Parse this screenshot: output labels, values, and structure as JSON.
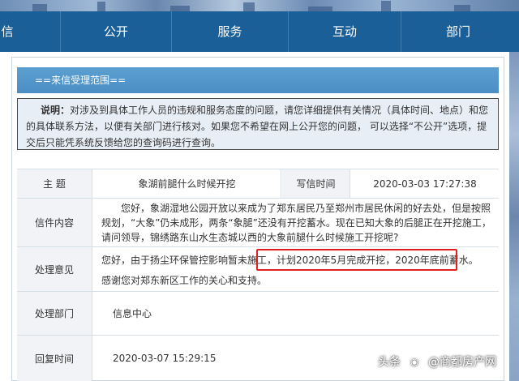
{
  "nav": {
    "items": [
      {
        "label": "政务信息",
        "shown": "信"
      },
      {
        "label": "公开"
      },
      {
        "label": "服务"
      },
      {
        "label": "互动"
      },
      {
        "label": "部门"
      }
    ]
  },
  "panel": {
    "title": "==来信受理范围==",
    "notice_label": "说明：",
    "notice_text": "对涉及到具体工作人员的违规和服务态度的问题，请您详细提供有关情况（具体时间、地点）和您的具体联系方法，以便有关部门进行核对。如果您不希望在网上公开您的问题， 可以选择“不公开”选项，提交后只能凭系统反馈给您的查询码进行查询。"
  },
  "letter": {
    "subject_label": "主 题",
    "subject": "象湖前腿什么时候开挖",
    "date_label": "写信时间",
    "date": "2020-03-03 17:27:38",
    "content_label": "信件内容",
    "content": "您好，象湖湿地公园开放以来成为了郑东居民乃至郑州市居民休闲的好去处，但是按照规划，“大象”仍未成形，两条“象腿”还没有开挖蓄水。现在已知大象的后腿正在开挖施工，请问领导，锦绣路东山水生态城以西的大象前腿什么时候施工开挖呢?",
    "reply_label": "处理意见",
    "reply_line1_a": "您好，由于扬尘环保管控影响暂未施工，",
    "reply_line1_b": "计划2020年5月完成开挖，2020年底前蓄水。",
    "reply_line2": "感谢您对郑东新区工作的关心和支持。",
    "dept_label": "处理部门",
    "dept": "信息中心",
    "reply_time_label": "回复时间",
    "reply_time": "2020-03-07 15:29:15"
  },
  "watermark": {
    "prefix": "头条",
    "account": "@商都房产网"
  }
}
